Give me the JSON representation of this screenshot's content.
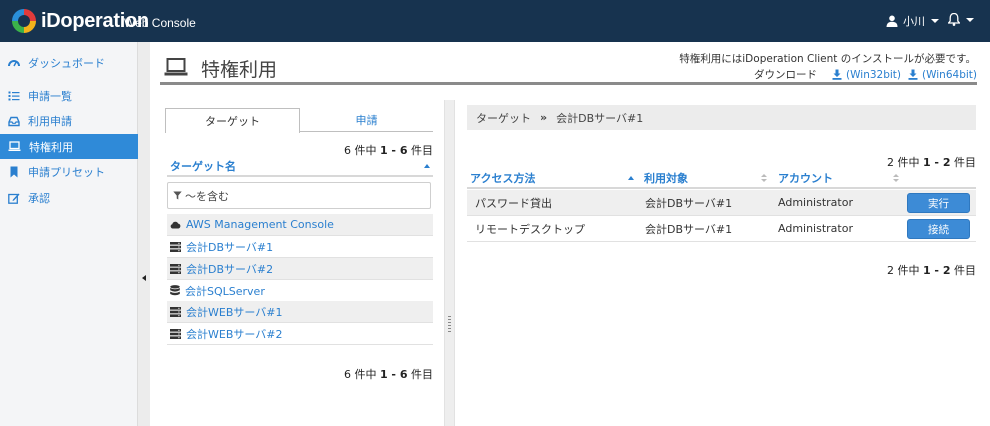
{
  "header": {
    "logo_text": "iDoperation",
    "logo_sub": "Web Console",
    "user_name": "小川"
  },
  "sidebar": {
    "items": [
      {
        "label": "ダッシュボード",
        "icon": "dashboard-icon",
        "active": false
      },
      {
        "label": "申請一覧",
        "icon": "list-icon",
        "active": false
      },
      {
        "label": "利用申請",
        "icon": "inbox-icon",
        "active": false
      },
      {
        "label": "特権利用",
        "icon": "laptop-icon",
        "active": true
      },
      {
        "label": "申請プリセット",
        "icon": "bookmark-icon",
        "active": false
      },
      {
        "label": "承認",
        "icon": "edit-icon",
        "active": false
      }
    ]
  },
  "page": {
    "title": "特権利用",
    "notice": "特権利用にはiDoperation Client のインストールが必要です。",
    "download_label": "ダウンロード",
    "download_win32": "(Win32bit)",
    "download_win64": "(Win64bit)"
  },
  "left_pane": {
    "tabs": [
      "ターゲット",
      "申請"
    ],
    "count_prefix": "6 件中 ",
    "count_range": "1 - 6",
    "count_suffix": " 件目",
    "column_header": "ターゲット名",
    "filter_placeholder": "～を含む",
    "targets": [
      {
        "name": "AWS Management Console",
        "icon": "cloud-icon"
      },
      {
        "name": "会計DBサーバ#1",
        "icon": "server-icon"
      },
      {
        "name": "会計DBサーバ#2",
        "icon": "server-icon"
      },
      {
        "name": "会計SQLServer",
        "icon": "database-icon"
      },
      {
        "name": "会計WEBサーバ#1",
        "icon": "server-icon"
      },
      {
        "name": "会計WEBサーバ#2",
        "icon": "server-icon"
      }
    ]
  },
  "right_pane": {
    "breadcrumb": [
      "ターゲット",
      "会計DBサーバ#1"
    ],
    "breadcrumb_sep": "»",
    "count_prefix": "2 件中 ",
    "count_range": "1 - 2",
    "count_suffix": " 件目",
    "columns": [
      "アクセス方法",
      "利用対象",
      "アカウント"
    ],
    "rows": [
      {
        "method": "パスワード貸出",
        "target": "会計DBサーバ#1",
        "account": "Administrator",
        "action": "実行"
      },
      {
        "method": "リモートデスクトップ",
        "target": "会計DBサーバ#1",
        "account": "Administrator",
        "action": "接続"
      }
    ]
  },
  "colors": {
    "header_bg": "#17334f",
    "accent": "#2f8ad8",
    "link": "#2a7fcf",
    "button": "#3d8bd6"
  }
}
